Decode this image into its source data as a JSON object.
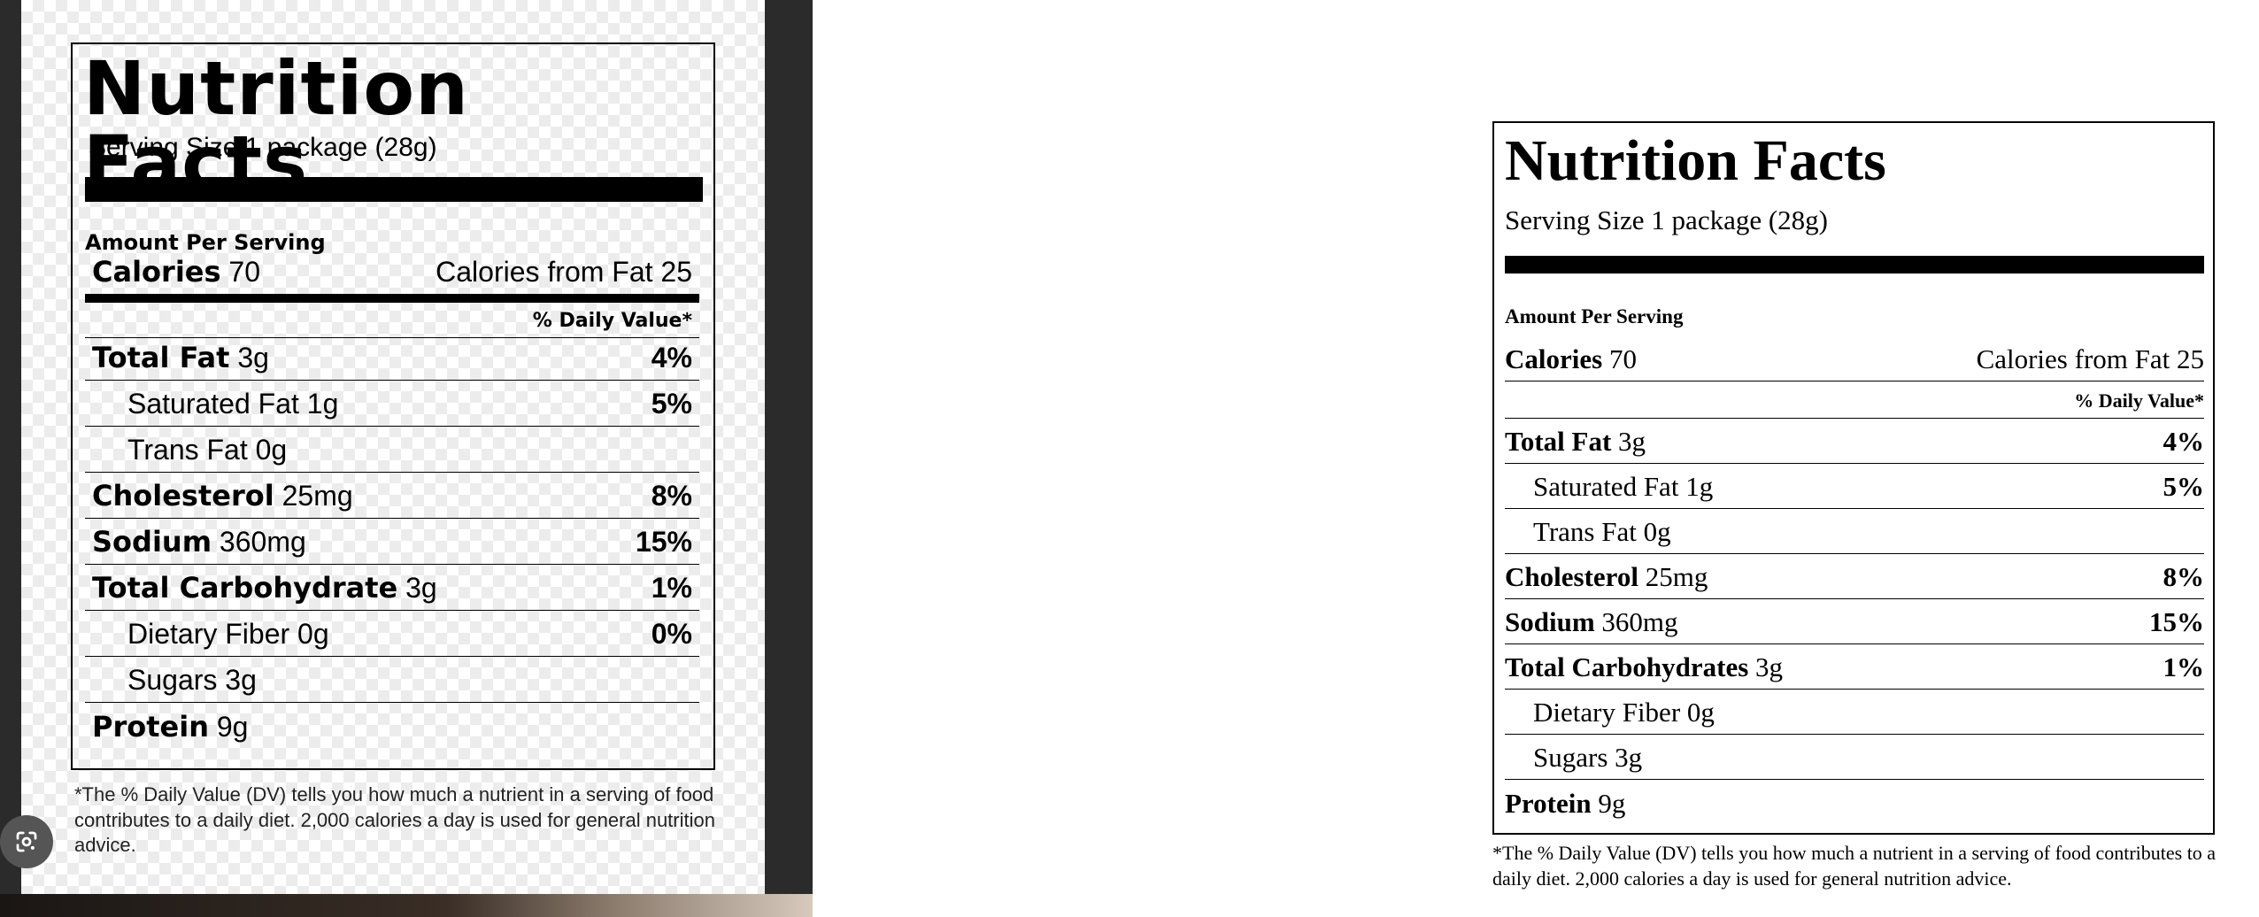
{
  "left_label": {
    "title": "Nutrition Facts",
    "serving_size": "Serving Size 1 package (28g)",
    "amount_per_serving": "Amount Per Serving",
    "calories_label": "Calories",
    "calories_value": "70",
    "calories_from_fat": "Calories from Fat 25",
    "daily_value_header": "% Daily Value*",
    "nutrients": [
      {
        "name": "Total Fat",
        "amount": "3g",
        "pct": "4%"
      },
      {
        "name": "Saturated Fat",
        "amount": "1g",
        "pct": "5%"
      },
      {
        "name": "Trans Fat",
        "amount": "0g",
        "pct": ""
      },
      {
        "name": "Cholesterol",
        "amount": "25mg",
        "pct": "8%"
      },
      {
        "name": "Sodium",
        "amount": "360mg",
        "pct": "15%"
      },
      {
        "name": "Total Carbohydrate",
        "amount": "3g",
        "pct": "1%"
      },
      {
        "name": "Dietary Fiber",
        "amount": "0g",
        "pct": "0%"
      },
      {
        "name": "Sugars",
        "amount": "3g",
        "pct": ""
      },
      {
        "name": "Protein",
        "amount": "9g",
        "pct": ""
      }
    ],
    "footnote": "*The % Daily Value (DV) tells you how much a nutrient in a serving of food contributes to a daily diet. 2,000 calories a day is used for general nutrition advice."
  },
  "right_label": {
    "title": "Nutrition Facts",
    "serving_size": "Serving Size 1 package (28g)",
    "amount_per_serving": "Amount Per Serving",
    "calories_label": "Calories",
    "calories_value": "70",
    "calories_from_fat": "Calories from Fat 25",
    "daily_value_header": "% Daily Value*",
    "nutrients": [
      {
        "name": "Total Fat",
        "amount": "3g",
        "pct": "4%"
      },
      {
        "name": "Saturated Fat",
        "amount": "1g",
        "pct": "5%"
      },
      {
        "name": "Trans Fat",
        "amount": "0g",
        "pct": ""
      },
      {
        "name": "Cholesterol",
        "amount": "25mg",
        "pct": "8%"
      },
      {
        "name": "Sodium",
        "amount": "360mg",
        "pct": "15%"
      },
      {
        "name": "Total Carbohydrates",
        "amount": "3g",
        "pct": "1%"
      },
      {
        "name": "Dietary Fiber",
        "amount": "0g",
        "pct": ""
      },
      {
        "name": "Sugars",
        "amount": "3g",
        "pct": ""
      },
      {
        "name": "Protein",
        "amount": "9g",
        "pct": ""
      }
    ],
    "footnote": "*The % Daily Value (DV) tells you how much a nutrient in a serving of food contributes to a daily diet. 2,000 calories a day is used for general nutrition advice."
  },
  "icons": {
    "lens_button": "google-lens-icon"
  }
}
